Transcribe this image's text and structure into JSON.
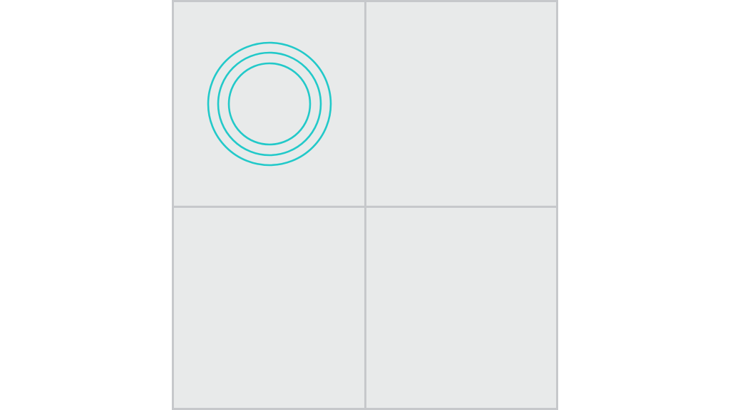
{
  "board": {
    "rows": 2,
    "cols": 2,
    "background_color": "#e8eaea",
    "grid_line_color": "#c6c8cb",
    "cells": [
      {
        "row": 0,
        "col": 0,
        "piece": "concentric-rings",
        "ring_count": 3
      },
      {
        "row": 0,
        "col": 1,
        "piece": null
      },
      {
        "row": 1,
        "col": 0,
        "piece": null
      },
      {
        "row": 1,
        "col": 1,
        "piece": null
      }
    ]
  },
  "piece_style": {
    "name": "concentric-rings-icon",
    "color": "#22c9c9"
  }
}
